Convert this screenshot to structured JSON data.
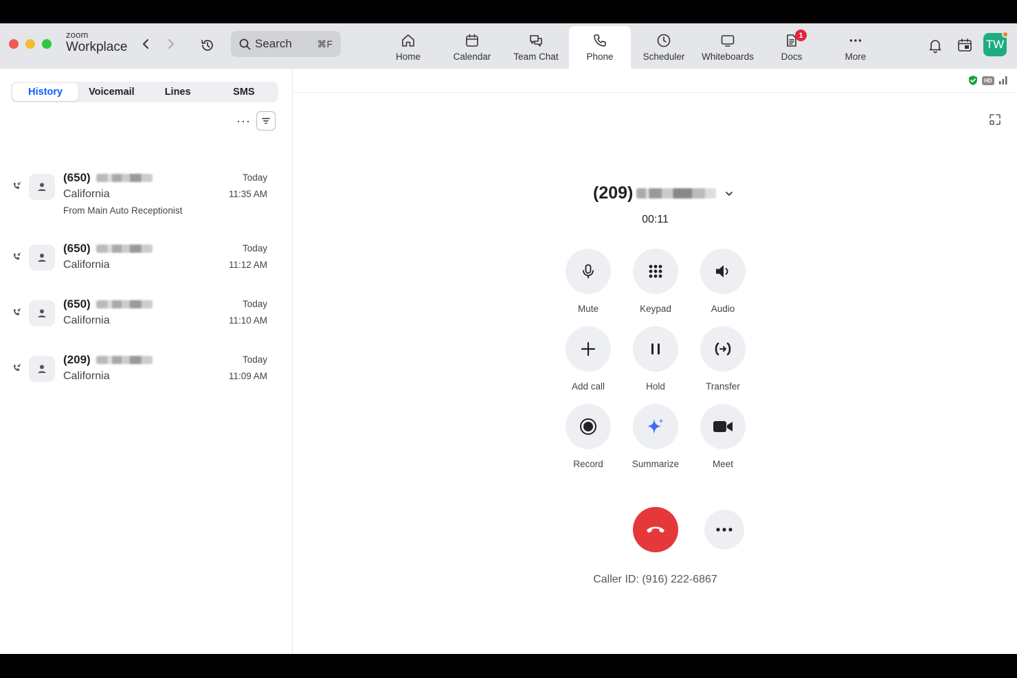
{
  "app": {
    "brand_top": "zoom",
    "brand_name": "Workplace"
  },
  "search": {
    "label": "Search",
    "shortcut": "⌘F"
  },
  "nav": [
    {
      "id": "home",
      "label": "Home"
    },
    {
      "id": "calendar",
      "label": "Calendar"
    },
    {
      "id": "team-chat",
      "label": "Team Chat"
    },
    {
      "id": "phone",
      "label": "Phone",
      "active": true
    },
    {
      "id": "scheduler",
      "label": "Scheduler"
    },
    {
      "id": "whiteboards",
      "label": "Whiteboards"
    },
    {
      "id": "docs",
      "label": "Docs",
      "badge": "1"
    },
    {
      "id": "more",
      "label": "More"
    }
  ],
  "user": {
    "initials": "TW",
    "avatar_color": "#1fad7e"
  },
  "tabs": {
    "history": "History",
    "voicemail": "Voicemail",
    "lines": "Lines",
    "sms": "SMS"
  },
  "history": [
    {
      "number": "(650)",
      "location": "California",
      "sub": "From Main Auto Receptionist",
      "day": "Today",
      "time": "11:35 AM"
    },
    {
      "number": "(650)",
      "location": "California",
      "day": "Today",
      "time": "11:12 AM"
    },
    {
      "number": "(650)",
      "location": "California",
      "day": "Today",
      "time": "11:10 AM"
    },
    {
      "number": "(209)",
      "location": "California",
      "day": "Today",
      "time": "11:09 AM"
    }
  ],
  "call": {
    "number": "(209)",
    "timer": "00:11",
    "controls": {
      "mute": "Mute",
      "keypad": "Keypad",
      "audio": "Audio",
      "add_call": "Add call",
      "hold": "Hold",
      "transfer": "Transfer",
      "record": "Record",
      "summarize": "Summarize",
      "meet": "Meet"
    },
    "caller_id": "Caller ID: (916) 222-6867",
    "hd_label": "HD"
  },
  "colors": {
    "accent": "#0b5cff",
    "hangup": "#e5383b",
    "badge": "#e0263c"
  }
}
